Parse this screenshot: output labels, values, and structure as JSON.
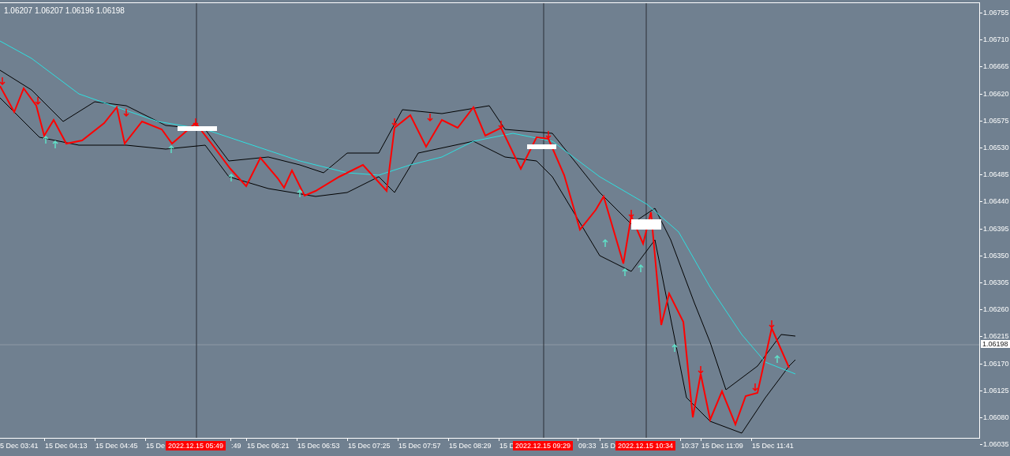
{
  "ohlc": "1.06207 1.06207 1.06196 1.06198",
  "price_axis": {
    "labels": [
      "1.06755",
      "1.06710",
      "1.06665",
      "1.06620",
      "1.06575",
      "1.06530",
      "1.06485",
      "1.06440",
      "1.06395",
      "1.06350",
      "1.06305",
      "1.06260",
      "1.06215",
      "1.06170",
      "1.06125",
      "1.06080",
      "1.06035"
    ],
    "current_price": "1.06198"
  },
  "time_axis": {
    "labels": [
      {
        "kind": "tick",
        "text": "5 Dec 03:41"
      },
      {
        "kind": "tick",
        "text": "15 Dec 04:13"
      },
      {
        "kind": "tick",
        "text": "15 Dec 04:45"
      },
      {
        "kind": "tick",
        "text": "15 De"
      },
      {
        "kind": "tick",
        "text": ":49"
      },
      {
        "kind": "tick",
        "text": "15 Dec 06:21"
      },
      {
        "kind": "tick",
        "text": "15 Dec 06:53"
      },
      {
        "kind": "tick",
        "text": "15 Dec 07:25"
      },
      {
        "kind": "tick",
        "text": "15 Dec 07:57"
      },
      {
        "kind": "tick",
        "text": "15 Dec 08:29"
      },
      {
        "kind": "tick",
        "text": "15 D"
      },
      {
        "kind": "tick",
        "text": "09:33"
      },
      {
        "kind": "tick",
        "text": "15 D"
      },
      {
        "kind": "tick",
        "text": "10:37"
      },
      {
        "kind": "tick",
        "text": "15 Dec 11:09"
      },
      {
        "kind": "tick",
        "text": "15 Dec 11:41"
      }
    ],
    "markers": [
      {
        "text": "2022.12.15 05:49"
      },
      {
        "text": "2022.12.15 09:29"
      },
      {
        "text": "2022.12.15 10:34"
      }
    ]
  }
}
